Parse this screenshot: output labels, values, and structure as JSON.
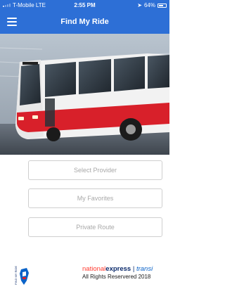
{
  "status_bar": {
    "carrier": "T-Mobile  LTE",
    "time": "2:55 PM",
    "battery": "64%",
    "battery_level": 0.64
  },
  "nav": {
    "title": "Find My Ride"
  },
  "buttons": {
    "select_provider": "Select Provider",
    "my_favorites": "My Favorites",
    "private_route": "Private Route"
  },
  "footer": {
    "brand_national": "national",
    "brand_express": "express",
    "brand_separator": "|",
    "brand_partial": "transi",
    "copyright": "All Rights Reservered 2018",
    "app_logo_text": "FIND MY RIDE"
  },
  "colors": {
    "header": "#2d6fd6",
    "bus_red": "#d8202a",
    "brand_red": "#ff3b30",
    "brand_navy": "#0b2a6b"
  }
}
